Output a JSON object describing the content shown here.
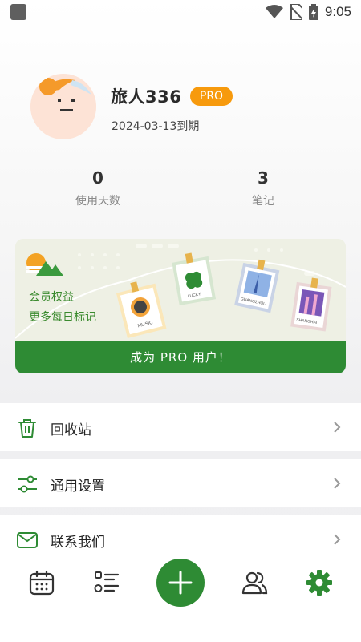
{
  "status_bar": {
    "time": "9:05"
  },
  "profile": {
    "username": "旅人336",
    "badge": "PRO",
    "expire_text": "2024-03-13到期"
  },
  "stats": [
    {
      "value": "0",
      "label": "使用天数"
    },
    {
      "value": "3",
      "label": "笔记"
    }
  ],
  "promo": {
    "line1": "会员权益",
    "line2": "更多每日标记",
    "button_label": "成为 PRO 用户！",
    "stamps": [
      "MUSIC",
      "LUCKY",
      "GUANGZHOU",
      "SHANGHAI"
    ]
  },
  "menu": [
    {
      "label": "回收站",
      "icon": "trash-icon"
    },
    {
      "label": "通用设置",
      "icon": "sliders-icon"
    },
    {
      "label": "联系我们",
      "icon": "mail-icon"
    }
  ],
  "bottom_nav": [
    {
      "icon": "calendar-icon"
    },
    {
      "icon": "list-icon"
    },
    {
      "icon": "plus-icon"
    },
    {
      "icon": "users-icon"
    },
    {
      "icon": "gear-icon",
      "active": true
    }
  ],
  "colors": {
    "accent": "#2e8b34",
    "badge": "#f79a0d"
  }
}
